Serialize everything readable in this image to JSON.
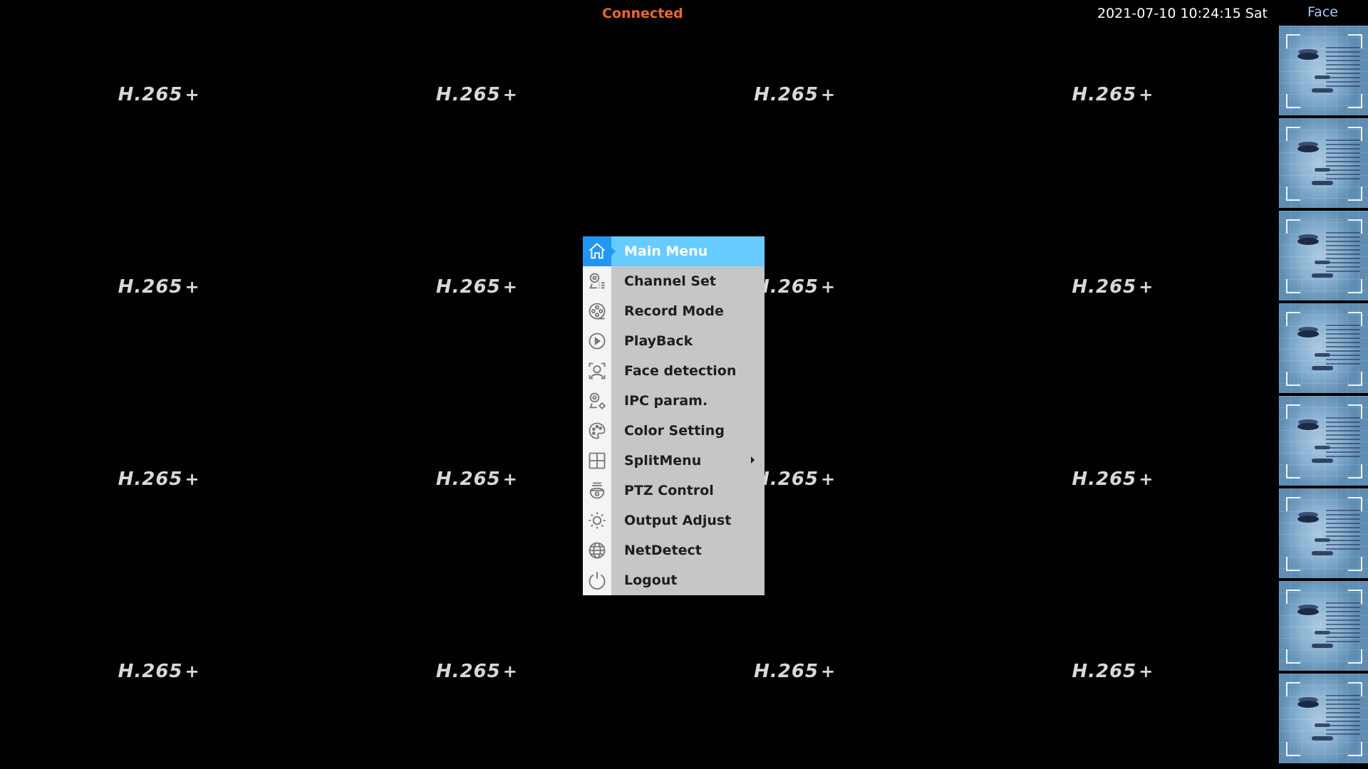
{
  "status_bar": {
    "connection_status": "Connected",
    "datetime": "2021-07-10 10:24:15 Sat",
    "connection_color": "#f2652a"
  },
  "face_panel": {
    "title": "Face",
    "thumbnail_count": 8
  },
  "channels": {
    "codec_label": "H.265",
    "codec_plus": "+",
    "count": 16
  },
  "menu": {
    "items": [
      {
        "label": "Main Menu",
        "icon": "home-icon",
        "active": true
      },
      {
        "label": "Channel Set",
        "icon": "camera-list-icon"
      },
      {
        "label": "Record Mode",
        "icon": "film-reel-icon"
      },
      {
        "label": "PlayBack",
        "icon": "play-circle-icon"
      },
      {
        "label": "Face detection",
        "icon": "face-scan-icon"
      },
      {
        "label": "IPC param.",
        "icon": "camera-gear-icon"
      },
      {
        "label": "Color Setting",
        "icon": "palette-icon"
      },
      {
        "label": "SplitMenu",
        "icon": "grid-split-icon",
        "has_submenu": true
      },
      {
        "label": "PTZ Control",
        "icon": "dome-camera-icon"
      },
      {
        "label": "Output Adjust",
        "icon": "sun-icon"
      },
      {
        "label": "NetDetect",
        "icon": "globe-icon"
      },
      {
        "label": "Logout",
        "icon": "power-icon"
      }
    ],
    "active_color": "#66ccff",
    "active_icon_bg": "#2196f3",
    "background": "#c6c6c6"
  }
}
